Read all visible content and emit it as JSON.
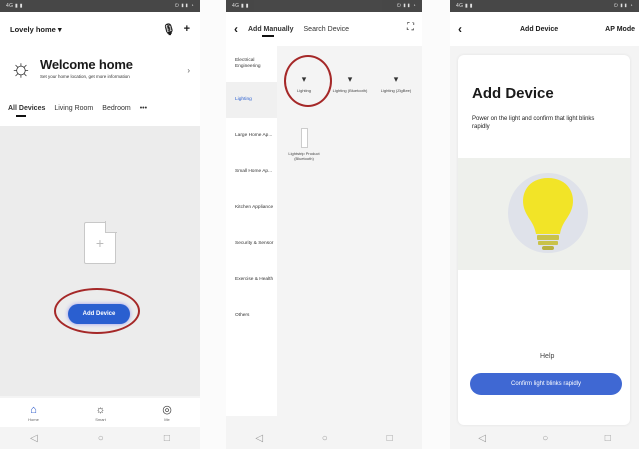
{
  "screen1": {
    "home_selector": "Lovely home",
    "welcome_title": "Welcome home",
    "welcome_sub": "Set your home location, get more information",
    "rooms": [
      "All Devices",
      "Living Room",
      "Bedroom"
    ],
    "more": "•••",
    "add_device": "Add Device",
    "tabs": [
      "Home",
      "Smart",
      "Me"
    ]
  },
  "screen2": {
    "tab_manual": "Add Manually",
    "tab_search": "Search Device",
    "categories": [
      "Electrical Engineering",
      "Lighting",
      "Large Home Ap...",
      "Small Home Ap...",
      "Kitchen Appliance",
      "Security & Sensor",
      "Exercise & Health",
      "Others"
    ],
    "devices": [
      "Lighting",
      "Lighting (Bluetooth)",
      "Lighting (ZigBee)",
      "Lightstrip Product (Bluetooth)"
    ]
  },
  "screen3": {
    "header_title": "Add Device",
    "ap_mode": "AP Mode",
    "title": "Add Device",
    "instruction": "Power on the light and confirm that light blinks rapidly",
    "help": "Help",
    "confirm": "Confirm light blinks rapidly"
  },
  "colors": {
    "accent": "#2a5fd0",
    "highlight_ring": "#a52828",
    "bulb": "#f2e427"
  }
}
